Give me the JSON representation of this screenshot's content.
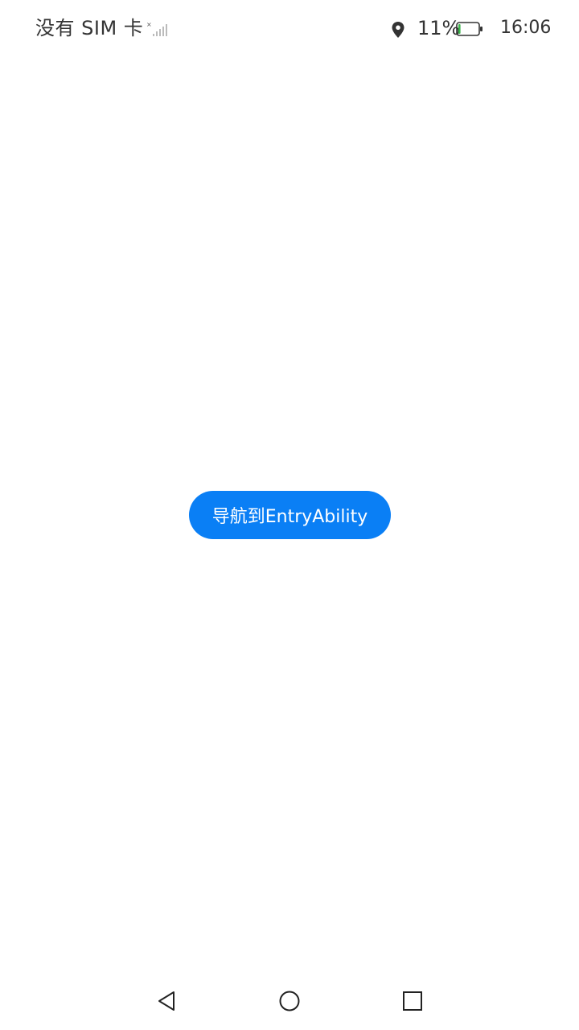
{
  "status_bar": {
    "carrier": "没有 SIM 卡",
    "battery_percent": "11%",
    "battery_level": 0.11,
    "time": "16:06",
    "icons": [
      "signal-no-sim-icon",
      "location-icon",
      "battery-icon"
    ]
  },
  "main": {
    "button_label": "导航到EntryAbility"
  },
  "nav_bar": {
    "keys": [
      "back-icon",
      "home-icon",
      "recents-icon"
    ]
  },
  "colors": {
    "accent": "#0a7ff5",
    "status_text": "#333333",
    "battery_fill": "#3bb54a"
  }
}
